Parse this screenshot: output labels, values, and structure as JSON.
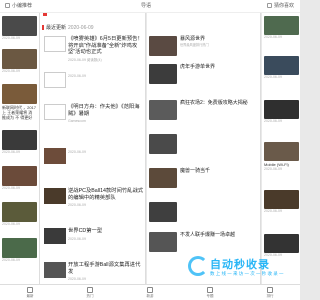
{
  "top_bar": {
    "title": "导语"
  },
  "left_panel": {
    "header": "小编推荐",
    "items": [
      {
        "text": "",
        "date": "2020-06-09"
      },
      {
        "text": "",
        "date": "2020-06-09"
      },
      {
        "text": "新联网时代\n，2017上\n王者荣耀将\n消 推成为\n不 得更好",
        "date": "2020-06-09"
      },
      {
        "text": "",
        "date": "2020-06-09"
      },
      {
        "text": "",
        "date": "2020-06-09"
      },
      {
        "text": "",
        "date": "2020-06-09"
      },
      {
        "text": "",
        "date": "2020-06-09"
      }
    ]
  },
  "center_panel": {
    "breadcrumb_label": "最近更新",
    "breadcrumb_date": "2020-06-09",
    "articles": [
      {
        "title": "《喷雾英雄》6月5日更新预告！将开启\"作战准备\"全新\"炸鸡攻坚\"活动也正式",
        "meta": "2020-06-09  阅读数(4)"
      },
      {
        "title": "",
        "meta": "2020-06-09"
      },
      {
        "title": "《明日方舟：作夫他》《范阳海贼》暑期",
        "meta": "Gamescom"
      },
      {
        "title": "",
        "meta": "2020-06-09"
      },
      {
        "title": "逆战PC及Ball14款时间竹乱战式的编辑中的精英部队 ",
        "meta": "2020-06-09"
      },
      {
        "title": "世界CD第一型",
        "meta": "2020-06-09"
      },
      {
        "title": "开放工程手游Ball源文集再进代发",
        "meta": "2020-06-09"
      }
    ]
  },
  "mid_panel": {
    "items": [
      {
        "title": "暴风源世界",
        "desc": "世界最风度排行热门"
      },
      {
        "title": "虎年手游单世界",
        "desc": ""
      },
      {
        "title": "疯狂农场2：免费版攻略大揭秘",
        "desc": ""
      },
      {
        "title": "",
        "desc": ""
      },
      {
        "title": "魔兽一骑当千",
        "desc": ""
      },
      {
        "title": "",
        "desc": ""
      },
      {
        "title": "不发人联手爆赚一场卓越",
        "desc": ""
      }
    ]
  },
  "right_panel": {
    "header": "猜你喜欢",
    "items": [
      {
        "text": "",
        "date": "2020-06-09"
      },
      {
        "text": "",
        "date": "2020-06-09"
      },
      {
        "text": "",
        "date": "2020-06-09"
      },
      {
        "text": "Mobile (Wi-Fi)",
        "date": "2020-06-09"
      },
      {
        "text": "",
        "date": "2020-06-09"
      },
      {
        "text": "",
        "date": "2020-06-09"
      }
    ]
  },
  "bottom_nav": {
    "items": [
      "最新",
      "热门",
      "新游",
      "专题",
      "排行"
    ]
  },
  "watermark": {
    "title": "自动秒收录",
    "subtitle": "数 上 线 一 来 访 一 次 一 秒 收 录 一"
  }
}
